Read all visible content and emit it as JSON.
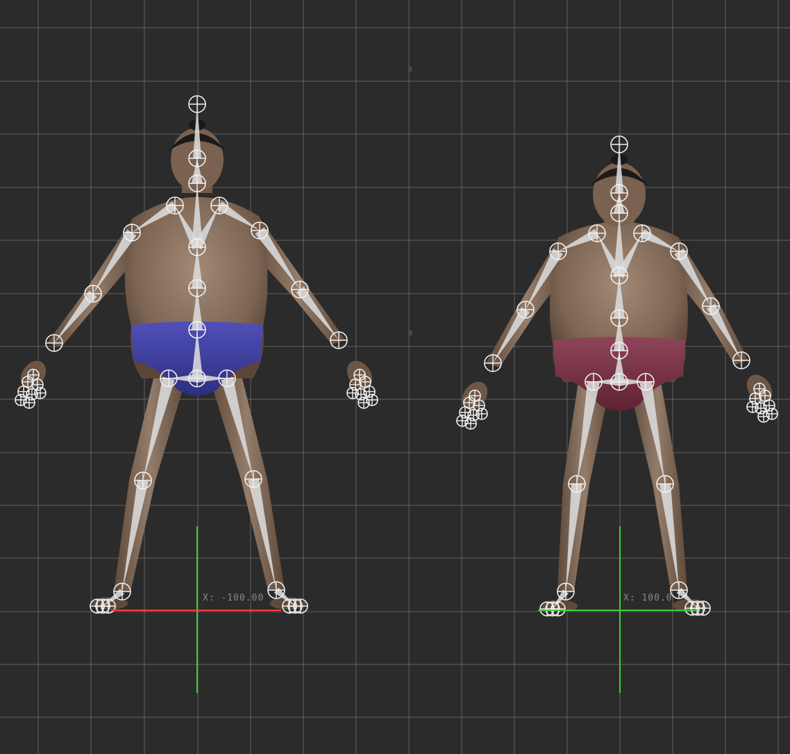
{
  "viewport": {
    "background": "#2b2b2b",
    "grid_color": "#8c8c8c",
    "view": "front orthographic"
  },
  "scene": {
    "origin_marker": "0",
    "characters": [
      {
        "name": "sumo-wrestler-left",
        "mawashi_color": "#3f3f9a",
        "axis_color": "#ff3b3b",
        "coordinate_label": "X: -100.00"
      },
      {
        "name": "sumo-wrestler-right",
        "mawashi_color": "#7a3044",
        "axis_color": "#39d13a",
        "coordinate_label": "X: 100.0"
      }
    ],
    "joint_icon": "circle-cross-icon",
    "bone_color": "#d8d8d8",
    "skin_color": "#8b7361"
  }
}
